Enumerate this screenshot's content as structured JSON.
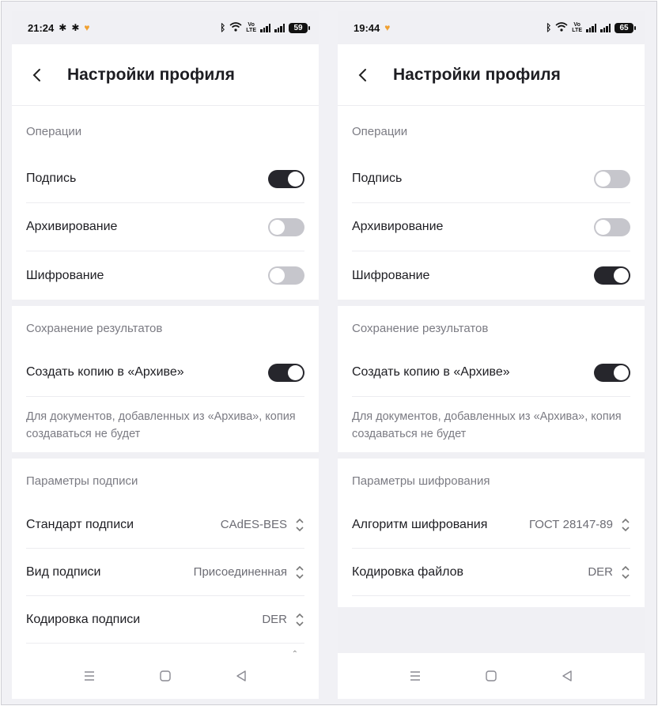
{
  "left": {
    "status": {
      "time": "21:24",
      "volte": "Vo\nLTE",
      "battery": "59"
    },
    "title": "Настройки профиля",
    "operations": {
      "section_title": "Операции",
      "items": [
        {
          "label": "Подпись",
          "on": true
        },
        {
          "label": "Архивирование",
          "on": false
        },
        {
          "label": "Шифрование",
          "on": false
        }
      ]
    },
    "results": {
      "section_title": "Сохранение результатов",
      "copy_label": "Создать копию в «Архиве»",
      "copy_on": true,
      "note": "Для документов, добавленных из «Архива», копия создаваться не будет"
    },
    "params": {
      "section_title": "Параметры подписи",
      "items": [
        {
          "label": "Стандарт подписи",
          "value": "CAdES-BES"
        },
        {
          "label": "Вид подписи",
          "value": "Присоединенная"
        },
        {
          "label": "Кодировка подписи",
          "value": "DER"
        }
      ]
    }
  },
  "right": {
    "status": {
      "time": "19:44",
      "volte": "Vo\nLTE",
      "battery": "65"
    },
    "title": "Настройки профиля",
    "operations": {
      "section_title": "Операции",
      "items": [
        {
          "label": "Подпись",
          "on": false
        },
        {
          "label": "Архивирование",
          "on": false
        },
        {
          "label": "Шифрование",
          "on": true
        }
      ]
    },
    "results": {
      "section_title": "Сохранение результатов",
      "copy_label": "Создать копию в «Архиве»",
      "copy_on": true,
      "note": "Для документов, добавленных из «Архива», копия создаваться не будет"
    },
    "params": {
      "section_title": "Параметры шифрования",
      "items": [
        {
          "label": "Алгоритм шифрования",
          "value": "ГОСТ 28147-89"
        },
        {
          "label": "Кодировка файлов",
          "value": "DER"
        }
      ]
    }
  },
  "colors": {
    "toggle_on": "#26262c",
    "toggle_off": "#c6c6cc",
    "muted_text": "#7b7b83",
    "background": "#f0f0f4"
  },
  "icons": [
    "back-chevron-icon",
    "bluetooth-icon",
    "wifi-icon",
    "signal-icon",
    "battery-icon",
    "menu-icon",
    "home-icon",
    "back-triangle-icon",
    "up-down-chevron-icon"
  ]
}
